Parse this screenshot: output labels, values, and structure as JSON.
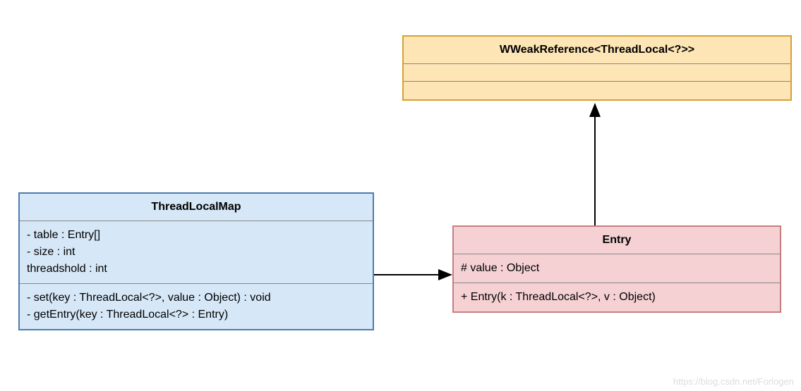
{
  "chart_data": {
    "type": "uml-class-diagram",
    "classes": [
      {
        "id": "ThreadLocalMap",
        "name": "ThreadLocalMap",
        "attributes": [
          "- table : Entry[]",
          "- size : int",
          "threadshold : int"
        ],
        "methods": [
          "- set(key :  ThreadLocal<?>, value : Object) : void",
          "- getEntry(key : ThreadLocal<?> : Entry)"
        ],
        "color": "blue"
      },
      {
        "id": "Entry",
        "name": "Entry",
        "attributes": [
          "# value : Object"
        ],
        "methods": [
          "+ Entry(k : ThreadLocal<?>, v : Object)"
        ],
        "color": "pink"
      },
      {
        "id": "WeakReference",
        "name": "WWeakReference<ThreadLocal<?>>",
        "attributes": [],
        "methods": [],
        "color": "orange"
      }
    ],
    "relations": [
      {
        "from": "ThreadLocalMap",
        "to": "Entry",
        "type": "association-arrow"
      },
      {
        "from": "Entry",
        "to": "WeakReference",
        "type": "generalization-arrow"
      }
    ]
  },
  "threadLocalMap": {
    "title": "ThreadLocalMap",
    "attr0": "- table : Entry[]",
    "attr1": "- size : int",
    "attr2": "threadshold : int",
    "m0": "- set(key :  ThreadLocal<?>, value : Object) : void",
    "m1": "- getEntry(key : ThreadLocal<?> : Entry)"
  },
  "entry": {
    "title": "Entry",
    "attr0": "# value : Object",
    "m0": "+ Entry(k : ThreadLocal<?>, v : Object)"
  },
  "weakref": {
    "title": "WWeakReference<ThreadLocal<?>>"
  },
  "watermark": "https://blog.csdn.net/Forlogen"
}
